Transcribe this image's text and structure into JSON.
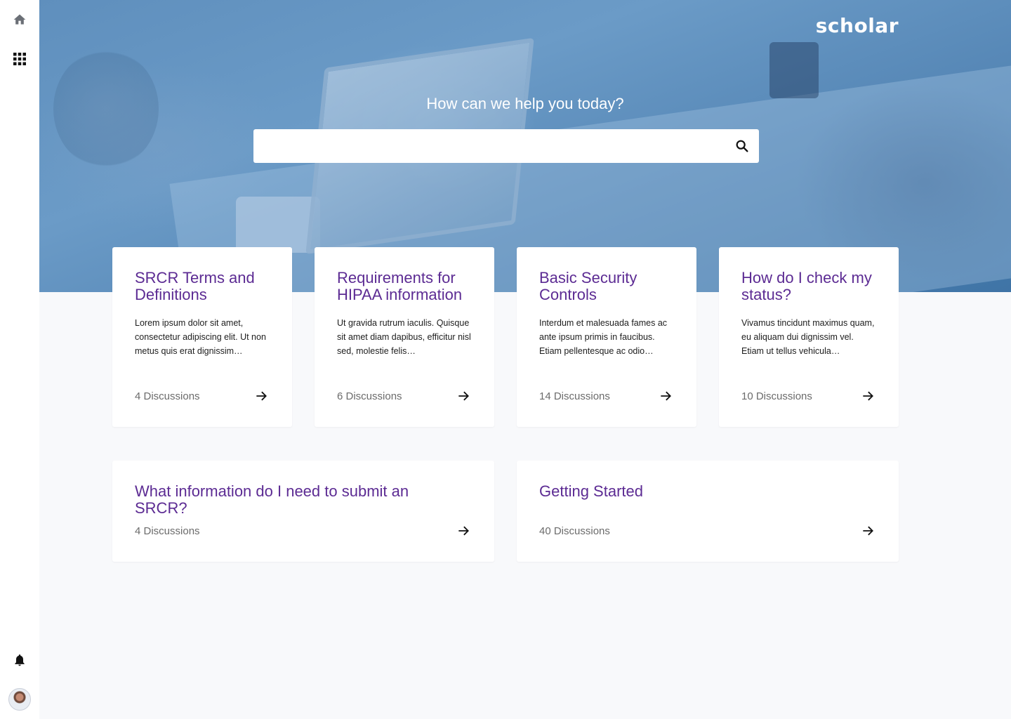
{
  "brand": {
    "logo_text": "scholar"
  },
  "sidebar": {
    "items": [
      {
        "icon": "home-icon"
      },
      {
        "icon": "apps-grid-icon"
      },
      {
        "icon": "bell-icon"
      },
      {
        "icon": "avatar"
      }
    ]
  },
  "hero": {
    "title": "How can we help you today?",
    "search": {
      "value": "",
      "placeholder": ""
    }
  },
  "topics": [
    {
      "title": "SRCR Terms and Definitions",
      "description": "Lorem ipsum dolor sit amet, consectetur adipiscing elit. Ut non metus quis erat dignissim…",
      "count": "4 Discussions"
    },
    {
      "title": "Requirements for HIPAA information",
      "description": "Ut gravida rutrum iaculis. Quisque sit amet diam dapibus, efficitur nisl sed, molestie felis…",
      "count": "6 Discussions"
    },
    {
      "title": "Basic Security Controls",
      "description": "Interdum et malesuada fames ac ante ipsum primis in faucibus. Etiam pellentesque ac odio…",
      "count": "14 Discussions"
    },
    {
      "title": "How do I check my status?",
      "description": "Vivamus tincidunt maximus quam, eu aliquam dui dignissim vel. Etiam ut tellus vehicula…",
      "count": "10 Discussions"
    },
    {
      "title": "What information do I need to submit an SRCR?",
      "description": "",
      "count": "4 Discussions"
    },
    {
      "title": "Getting Started",
      "description": "",
      "count": "40 Discussions"
    }
  ],
  "colors": {
    "accent": "#5c2b93",
    "hero_blue": "#5f8fbd",
    "page_bg": "#f8f9fb"
  }
}
